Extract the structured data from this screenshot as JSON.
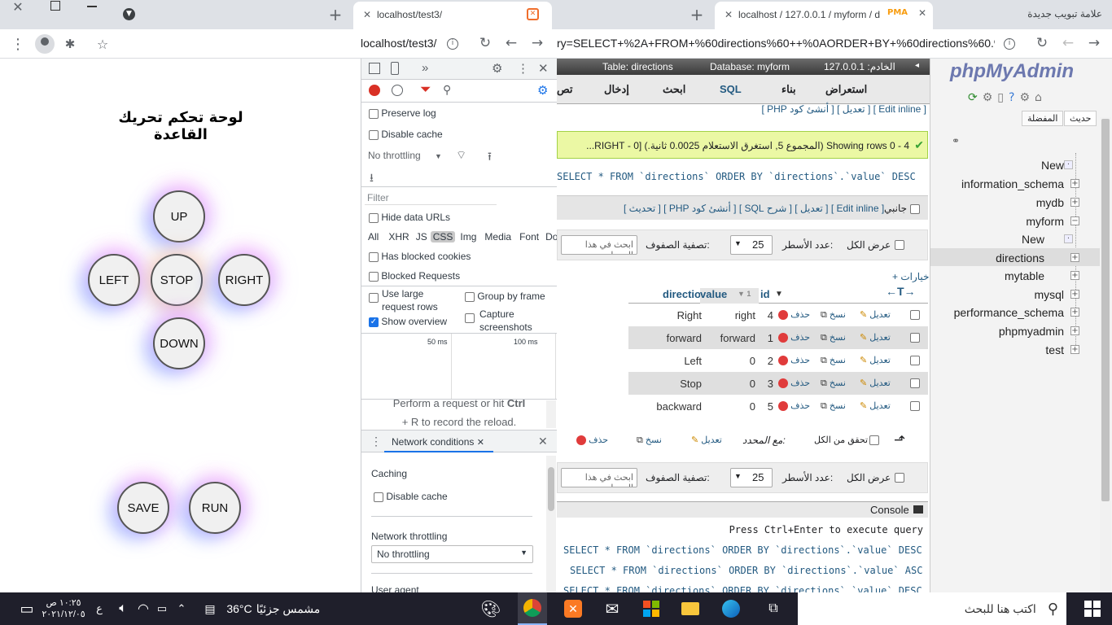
{
  "left_browser": {
    "tab_title": "localhost/test3/",
    "address": "localhost/test3/",
    "page": {
      "title": "لوحة تحكم تحريك القاعدة",
      "buttons": {
        "up": "UP",
        "left": "LEFT",
        "stop": "STOP",
        "right": "RIGHT",
        "down": "DOWN",
        "save": "SAVE",
        "run": "RUN"
      }
    },
    "devtools": {
      "preserve_log": "Preserve log",
      "disable_cache": "Disable cache",
      "throttling": "No throttling",
      "filter_placeholder": "Filter",
      "hide_data_urls": "Hide data URLs",
      "types": [
        "All",
        "XHR",
        "JS",
        "CSS",
        "Img",
        "Media",
        "Font",
        "Do"
      ],
      "has_blocked_cookies": "Has blocked cookies",
      "blocked_requests": "Blocked Requests",
      "use_large_rows": "Use large request rows",
      "group_by_frame": "Group by frame",
      "show_overview": "Show overview",
      "capture_screenshots": "Capture screenshots",
      "t50": "50 ms",
      "t100": "100 ms",
      "hint1": "Perform a request or hit",
      "hint_key": "Ctrl",
      "hint2": "+ R to record the reload.",
      "drawer_tab": "Network conditions",
      "caching": "Caching",
      "drawer_disable_cache": "Disable cache",
      "network_throttling": "Network throttling",
      "throttle_select": "No throttling",
      "user_agent": "User agent"
    }
  },
  "right_browser": {
    "tab_new": "علامة تبويب جديدة",
    "tab_pma": "localhost / 127.0.0.1 / myform / d",
    "address": "ry=SELECT+%2A+FROM+%60directions%60++%0AORDER+BY+%60directions%60.%...",
    "breadcrumb": {
      "server": "الخادم: 127.0.0.1",
      "database": "Database: myform",
      "table": "Table: directions"
    },
    "toolbar": [
      "استعراض",
      "بناء",
      "SQL",
      "ابحث",
      "إدخال",
      "تص"
    ],
    "edit_links": "[ Edit inline ] [ تعديل ] [ أنشئ كود PHP ]",
    "showing": "Showing rows 0 - 4 (المجموع 5, استغرق الاستعلام 0.0025 ثانية.) [0 - RIGHT...",
    "query": "SELECT * FROM `directions` ORDER BY `directions`.`value` DESC",
    "profiling": "جانبي",
    "query_links": "[ Edit inline ] [ تعديل ] [ شرح SQL ] [ أنشئ كود PHP ] [ تحديث ]",
    "show_all": "عرض الكل",
    "num_rows_label": "عدد الأسطر:",
    "num_rows": "25",
    "filter_label": "تصفية الصفوف:",
    "filter_placeholder": "ابحث في هذا الجدول",
    "options": "+ خيارات",
    "columns": [
      "direction",
      "value",
      "id"
    ],
    "action_labels": {
      "edit": "تعديل",
      "copy": "نسخ",
      "delete": "حذف"
    },
    "rows": [
      {
        "direction": "Right",
        "value": "right",
        "id": "4"
      },
      {
        "direction": "forward",
        "value": "forward",
        "id": "1"
      },
      {
        "direction": "Left",
        "value": "0",
        "id": "2"
      },
      {
        "direction": "Stop",
        "value": "0",
        "id": "3"
      },
      {
        "direction": "backward",
        "value": "0",
        "id": "5"
      }
    ],
    "check_all": "تحقق من الكل",
    "with_selected": "مع المحدد:",
    "console_title": "Console",
    "console_hint": "Press Ctrl+Enter to execute query",
    "console_lines": [
      "SELECT * FROM `directions` ORDER BY `directions`.`value` DESC",
      "SELECT * FROM `directions` ORDER BY `directions`.`value` ASC",
      "SELECT * FROM `directions` ORDER BY `directions`.`value` DESC"
    ],
    "nav": {
      "logo": "phpMyAdmin",
      "recent": "حديث",
      "favorites": "المفضلة",
      "items": [
        "New",
        "information_schema",
        "mydb",
        "myform",
        "New",
        "directions",
        "mytable",
        "mysql",
        "performance_schema",
        "phpmyadmin",
        "test"
      ]
    }
  },
  "taskbar": {
    "search": "اكتب هنا للبحث",
    "weather": "مشمس جزئيًا",
    "temp": "36°C",
    "time": "١٠:٢٥ ص",
    "date": "٢٠٢١/١٢/٠٥",
    "lang": "ع"
  }
}
